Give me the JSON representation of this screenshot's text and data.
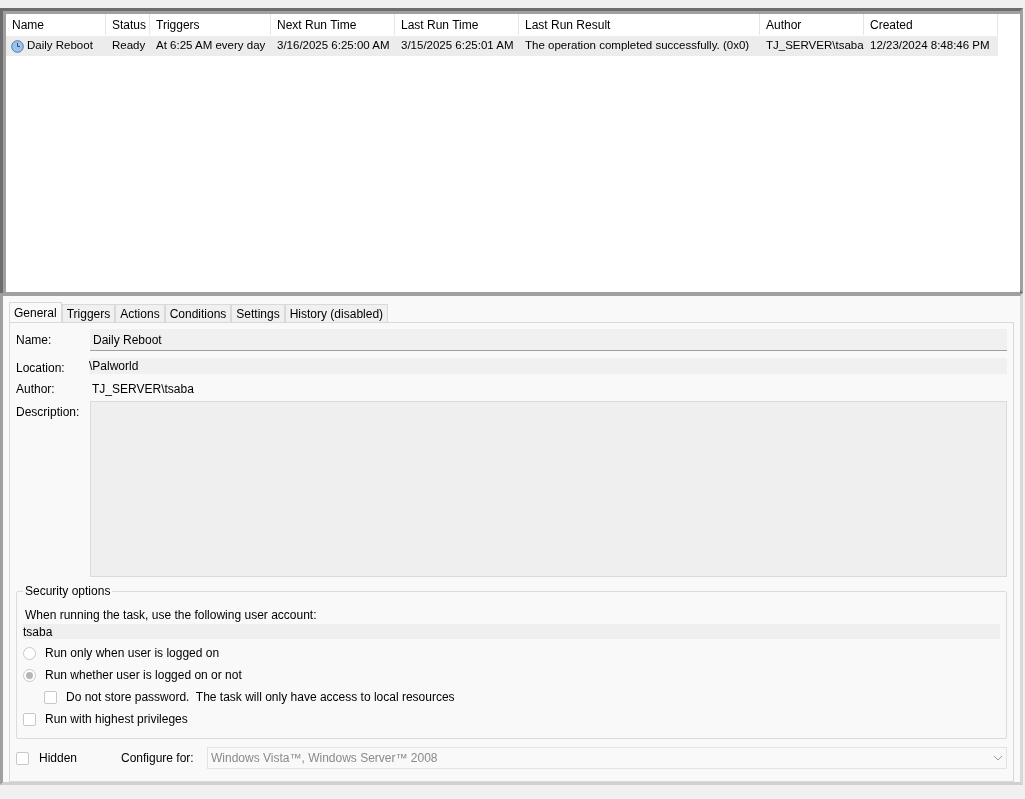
{
  "task_list": {
    "columns": [
      {
        "label": "Name"
      },
      {
        "label": "Status"
      },
      {
        "label": "Triggers"
      },
      {
        "label": "Next Run Time"
      },
      {
        "label": "Last Run Time"
      },
      {
        "label": "Last Run Result"
      },
      {
        "label": "Author"
      },
      {
        "label": "Created"
      }
    ],
    "rows": [
      {
        "selected": true,
        "cells": [
          "Daily Reboot",
          "Ready",
          "At 6:25 AM every day",
          "3/16/2025 6:25:00 AM",
          "3/15/2025 6:25:01 AM",
          "The operation completed successfully. (0x0)",
          "TJ_SERVER\\tsaba",
          "12/23/2024 8:48:46 PM"
        ]
      }
    ]
  },
  "tabs": [
    {
      "label": "General",
      "selected": true
    },
    {
      "label": "Triggers",
      "selected": false
    },
    {
      "label": "Actions",
      "selected": false
    },
    {
      "label": "Conditions",
      "selected": false
    },
    {
      "label": "Settings",
      "selected": false
    },
    {
      "label": "History (disabled)",
      "selected": false
    }
  ],
  "general": {
    "name_label": "Name:",
    "name_value": "Daily Reboot",
    "location_label": "Location:",
    "location_value": "\\Palworld",
    "author_label": "Author:",
    "author_value": "TJ_SERVER\\tsaba",
    "description_label": "Description:"
  },
  "security": {
    "title": "Security options",
    "account_label": "When running the task, use the following user account:",
    "account_value": "tsaba",
    "options": [
      {
        "kind": "radio",
        "label": "Run only when user is logged on",
        "checked": false
      },
      {
        "kind": "radio",
        "label": "Run whether user is logged on or not",
        "checked": true,
        "children": [
          {
            "kind": "checkbox",
            "label": "Do not store password.  The task will only have access to local resources",
            "checked": false
          }
        ]
      },
      {
        "kind": "checkbox",
        "label": "Run with highest privileges",
        "checked": false
      }
    ]
  },
  "footer": {
    "hidden_label": "Hidden",
    "hidden_checked": false,
    "configure_label": "Configure for:",
    "configure_value": "Windows Vista™, Windows Server™ 2008"
  }
}
